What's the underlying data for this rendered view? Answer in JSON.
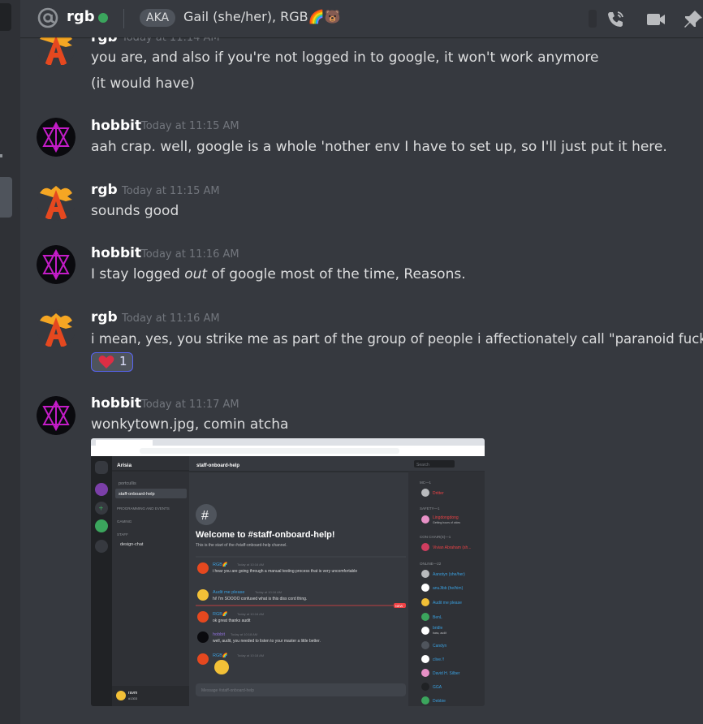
{
  "header": {
    "username": "rgb",
    "aka_label": "AKA",
    "nickname": "Gail (she/her), RGB🌈🐻",
    "icons": [
      "at-icon",
      "call-icon",
      "video-icon",
      "pin-icon"
    ]
  },
  "messages": [
    {
      "author": "rgb",
      "timestamp": "Today at 11:14 AM",
      "lines": [
        "you are, and also if you're not logged in to google, it won't work anymore",
        "(it would have)"
      ]
    },
    {
      "author": "hobbit",
      "timestamp": "Today at 11:15 AM",
      "lines": [
        "aah crap.  well, google is a whole 'nother env I have to set up, so I'll just put it here."
      ]
    },
    {
      "author": "rgb",
      "timestamp": "Today at 11:15 AM",
      "lines": [
        "sounds good"
      ]
    },
    {
      "author": "hobbit",
      "timestamp": "Today at 11:16 AM",
      "before": "I stay logged ",
      "emph": "out",
      "after": " of google most of the time, Reasons."
    },
    {
      "author": "rgb",
      "timestamp": "Today at 11:16 AM",
      "lines": [
        "i mean, yes, you strike me as part of the group of people i affectionately call \"paranoid fucks\""
      ],
      "reaction": {
        "emoji": "❤️",
        "count": "1"
      }
    },
    {
      "author": "hobbit",
      "timestamp": "Today at 11:17 AM",
      "lines": [
        "wonkytown.jpg, comin atcha"
      ]
    }
  ],
  "attachment": {
    "server_name": "Arisia",
    "channels": [
      "portcullis",
      "staff-onboard-help"
    ],
    "categories": [
      "PROGRAMMING AND EVENTS",
      "GAMING",
      "STAFF"
    ],
    "staff_channel": "design-chat",
    "channel_header": "staff-onboard-help",
    "search_placeholder": "Search",
    "hash_glyph": "#",
    "welcome_title": "Welcome to #staff-onboard-help!",
    "welcome_sub": "This is the start of the #staff-onboard-help channel.",
    "chat": [
      {
        "author": "RGB🌈",
        "time": "Today at 10:16 AM",
        "text": "i hear you are going through a manual testing process that is very uncomfortable"
      },
      {
        "author": "Audit me please",
        "time": "Today at 10:16 AM",
        "text": "hi!  I'm SOOOO confused what is this diss cord thing."
      },
      {
        "author": "RGB🌈",
        "time": "Today at 10:16 AM",
        "text": "ok great thanks audit"
      },
      {
        "author": "hobbit",
        "time": "Today at 10:18 AM",
        "text": "well, audit, you needed to listen to your master a little better."
      },
      {
        "author": "RGB🌈",
        "time": "Today at 10:18 AM",
        "text": ""
      }
    ],
    "new_badge": "NEW",
    "input_placeholder": "Message #staff-onboard-help",
    "user_name": "ravm",
    "user_tag": "#1303",
    "member_sections": [
      {
        "title": "MC—1",
        "members": [
          "Dritter"
        ]
      },
      {
        "title": "SAFETY—1",
        "members": [
          "Lingdongdong"
        ],
        "status": "Getting hours of video"
      },
      {
        "title": "CON CHAIR(S)—1",
        "members": [
          "Vivian Abraham (sh..."
        ]
      },
      {
        "title": "ONLINE—22",
        "members": [
          "Aanotyn (she/her)",
          "anuJibb (he/him)",
          "Audit me please",
          "BenL",
          "bridle",
          "Candyn",
          "clive.!!",
          "David H. Silber",
          "GGA",
          "Debbie"
        ]
      }
    ],
    "bridle_status": "bass, audit"
  }
}
